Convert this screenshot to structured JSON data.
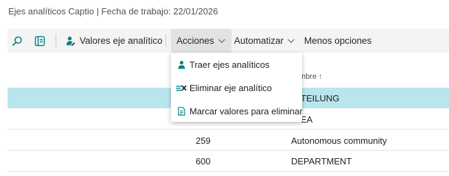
{
  "page": {
    "title": "Ejes analíticos Captio | Fecha de trabajo: 22/01/2026"
  },
  "toolbar": {
    "valores_label": "Valores eje analítico",
    "acciones_label": "Acciones",
    "automatizar_label": "Automatizar",
    "menos_label": "Menos opciones"
  },
  "acciones_menu": {
    "items": [
      {
        "label": "Traer ejes analíticos",
        "icon": "person-icon"
      },
      {
        "label": "Eliminar eje analítico",
        "icon": "delete-row-icon"
      },
      {
        "label": "Marcar valores para eliminar",
        "icon": "document-icon"
      }
    ]
  },
  "table": {
    "header_partial": "mbre ↑",
    "rows": [
      {
        "code": "",
        "name_partial": "TEILUNG",
        "selected": true
      },
      {
        "code": "",
        "name_partial": "EA",
        "selected": false
      },
      {
        "code": "259",
        "name": "Autonomous community",
        "selected": false
      },
      {
        "code": "600",
        "name": "DEPARTMENT",
        "selected": false
      }
    ]
  },
  "colors": {
    "accent": "#00848a",
    "selected_row": "#b8e6ec",
    "toolbar_bg": "#f4f4f4",
    "menu_open_bg": "#e2e2e2"
  }
}
